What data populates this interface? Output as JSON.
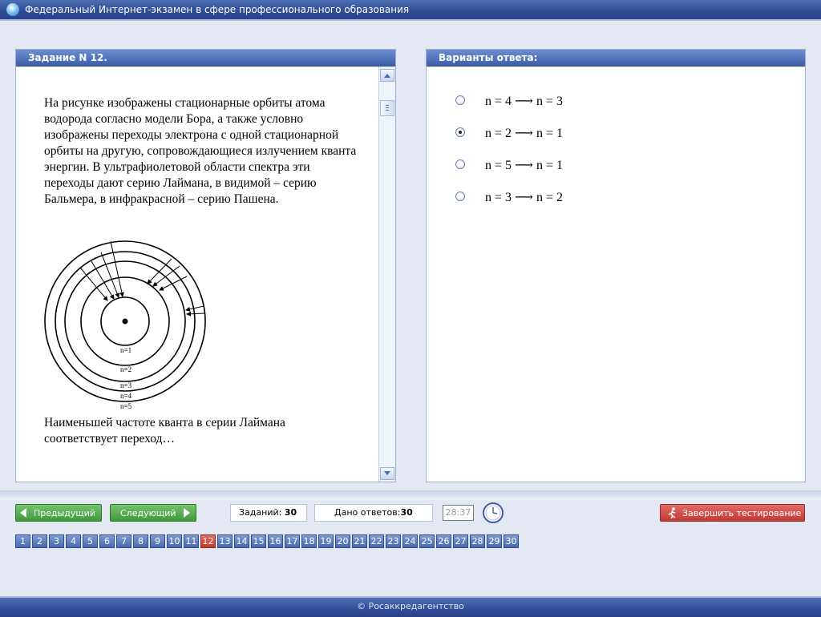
{
  "window": {
    "title": "Федеральный Интернет-экзамен в сфере профессионального образования"
  },
  "task_panel": {
    "header": "Задание N 12.",
    "paragraph": "На рисунке изображены стационарные орбиты атома водорода согласно модели Бора, а также условно изображены переходы электрона с одной стационарной орбиты на другую, сопровождающиеся излучением кванта энергии. В ультрафиолетовой области спектра эти переходы дают серию Лаймана, в видимой – серию Бальмера, в инфракрасной – серию Пашена.",
    "figure_labels": [
      "n=1",
      "n=2",
      "n=3",
      "n=4",
      "n=5"
    ],
    "question": "Наименьшей частоте кванта в серии Лаймана соответствует переход…"
  },
  "answer_panel": {
    "header": "Варианты ответа:",
    "options": [
      {
        "label": "n = 4 ⟶ n = 3",
        "selected": false
      },
      {
        "label": "n = 2 ⟶ n = 1",
        "selected": true
      },
      {
        "label": "n = 5 ⟶ n = 1",
        "selected": false
      },
      {
        "label": "n = 3 ⟶ n = 2",
        "selected": false
      }
    ]
  },
  "toolbar": {
    "prev_label": "Предыдущий",
    "next_label": "Следующий",
    "tasks_label": "Заданий:",
    "tasks_value": "30",
    "answered_label": "Дано ответов:",
    "answered_value": "30",
    "timer": "28:37",
    "finish_label": "Завершить тестирование"
  },
  "pages": {
    "numbers": [
      "1",
      "2",
      "3",
      "4",
      "5",
      "6",
      "7",
      "8",
      "9",
      "10",
      "11",
      "12",
      "13",
      "14",
      "15",
      "16",
      "17",
      "18",
      "19",
      "20",
      "21",
      "22",
      "23",
      "24",
      "25",
      "26",
      "27",
      "28",
      "29",
      "30"
    ],
    "current": "12"
  },
  "footer": {
    "text": "© Росаккредагентство"
  },
  "colors": {
    "header_blue": "#3b5ea9",
    "nav_green": "#3f9a3a",
    "finish_red": "#c23a35",
    "current_page": "#c33a30"
  }
}
